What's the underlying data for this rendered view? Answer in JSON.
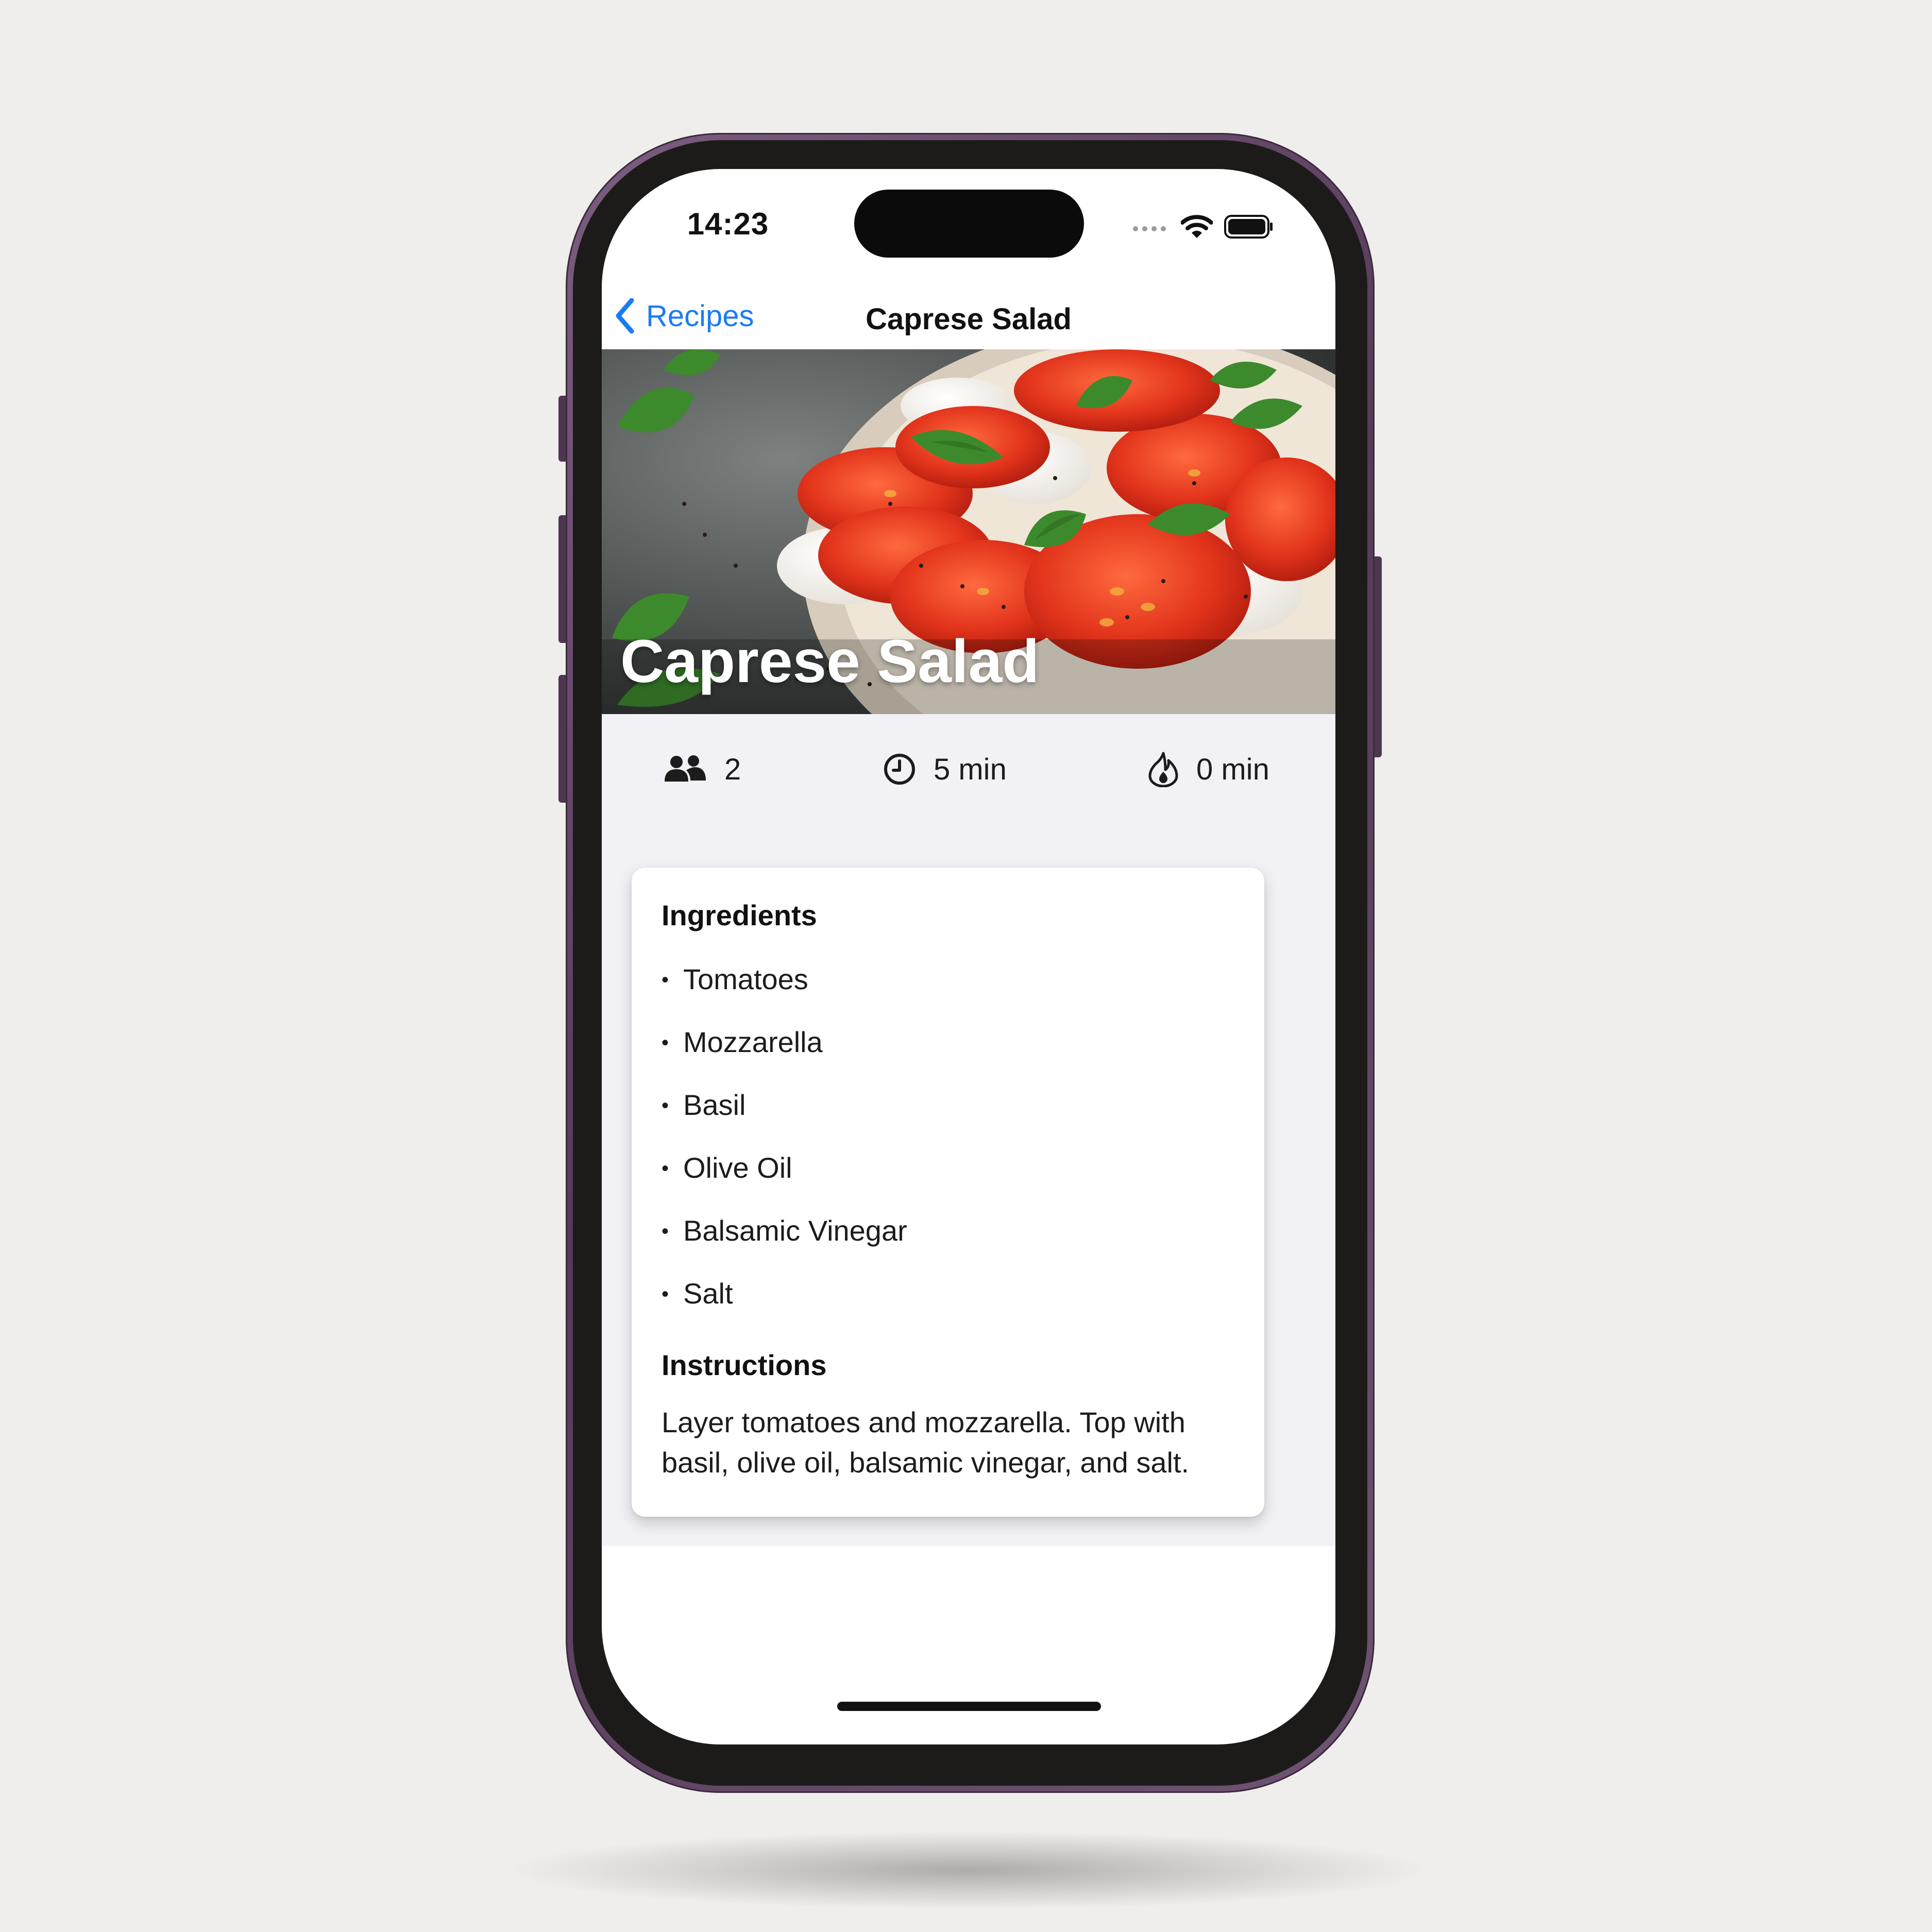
{
  "status_bar": {
    "time": "14:23",
    "icons": [
      "cellular-icon",
      "wifi-icon",
      "battery-icon"
    ]
  },
  "nav": {
    "back_label": "Recipes",
    "title": "Caprese Salad"
  },
  "hero": {
    "title": "Caprese Salad",
    "image_icon": "caprese-salad-photo"
  },
  "stats": {
    "servings": "2",
    "prep_time": "5 min",
    "cook_time": "0 min"
  },
  "ingredients": {
    "heading": "Ingredients",
    "bullet": "•",
    "items": [
      "Tomatoes",
      "Mozzarella",
      "Basil",
      "Olive Oil",
      "Balsamic Vinegar",
      "Salt"
    ]
  },
  "instructions": {
    "heading": "Instructions",
    "text": "Layer tomatoes and mozzarella. Top with basil, olive oil, balsamic vinegar, and salt."
  },
  "colors": {
    "accent": "#1a7cf5",
    "phone_frame": "#5e4262",
    "content_bg": "#f2f1f6"
  }
}
